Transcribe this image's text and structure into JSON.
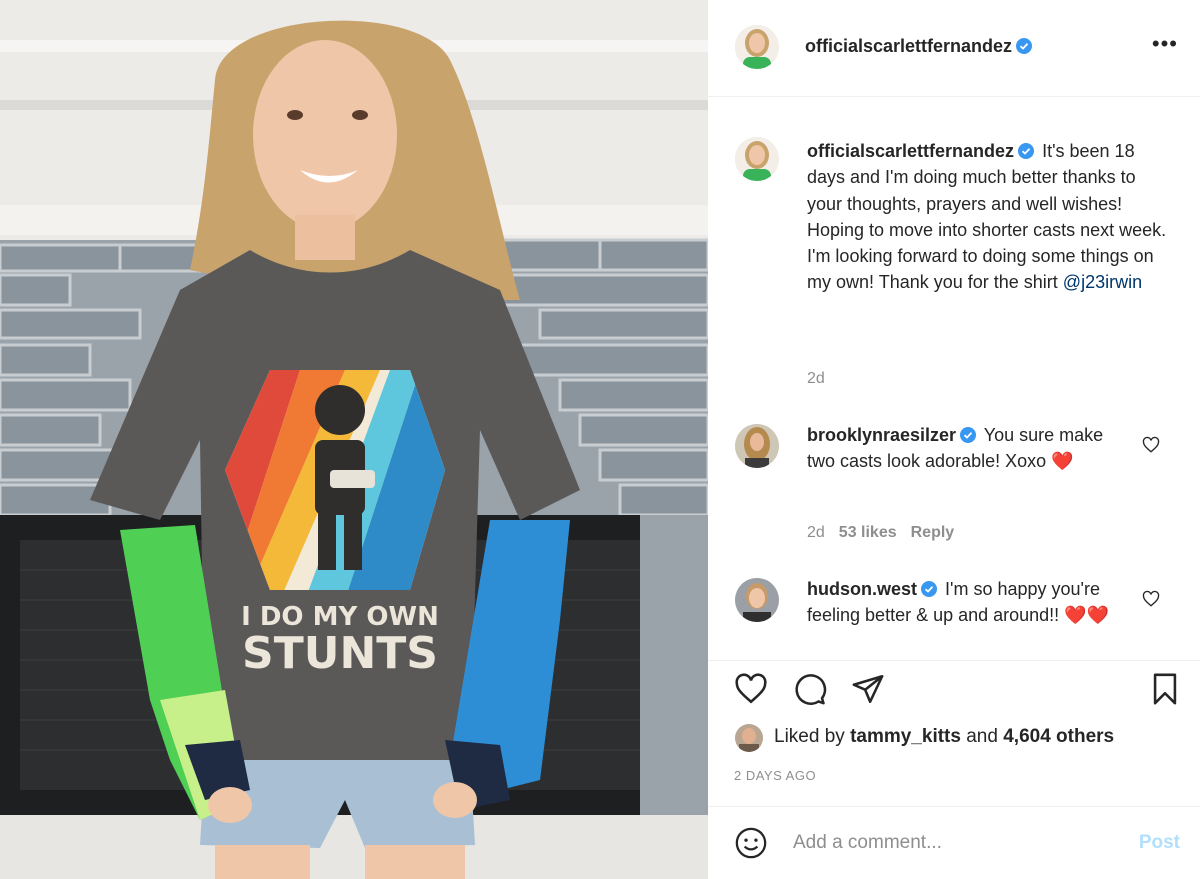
{
  "post": {
    "username": "officialscarlettfernandez",
    "more_label": "•••",
    "caption": {
      "username": "officialscarlettfernandez",
      "text": "It's been 18 days and I'm doing much better thanks to your thoughts, prayers and well wishes! Hoping to move into shorter casts next week. I'm looking forward to doing some things on my own! Thank you for the shirt",
      "mention": "@j23irwin",
      "time": "2d"
    },
    "photo": {
      "shirt_text_line1": "I DO MY OWN",
      "shirt_text_line2": "STUNTS"
    },
    "comments": [
      {
        "username": "brooklynraesilzer",
        "text": "You sure make two casts look adorable! Xoxo",
        "emoji": "❤️",
        "time": "2d",
        "likes": "53 likes",
        "reply": "Reply"
      },
      {
        "username": "hudson.west",
        "text": "I'm so happy you're feeling better & up and around!!",
        "emoji": "❤️❤️"
      }
    ],
    "likes": {
      "prefix": "Liked by",
      "user": "tammy_kitts",
      "middle": "and",
      "others": "4,604 others"
    },
    "timestamp": "2 DAYS AGO",
    "add_comment": {
      "placeholder": "Add a comment...",
      "post_label": "Post"
    },
    "colors": {
      "verified": "#3897f0",
      "mention": "#00376b",
      "muted": "#8e8e8e",
      "post_disabled": "#b2dffc"
    }
  }
}
